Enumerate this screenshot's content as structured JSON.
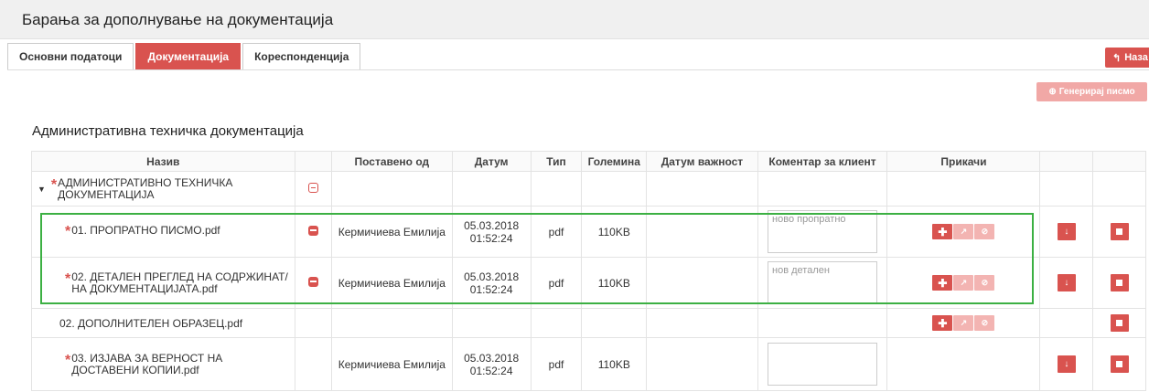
{
  "header": {
    "title": "Барања за дополнување на документација"
  },
  "tabs": [
    {
      "label": "Основни податоци",
      "active": false
    },
    {
      "label": "Документација",
      "active": true
    },
    {
      "label": "Кореспонденција",
      "active": false
    }
  ],
  "actions": {
    "back_label": "Наза",
    "generate_label": "Генерирај писмо"
  },
  "section": {
    "title": "Административна техничка документација"
  },
  "table": {
    "columns": [
      "Назив",
      "",
      "Поставено од",
      "Датум",
      "Тип",
      "Големина",
      "Датум важност",
      "Коментар за клиент",
      "Прикачи",
      "",
      ""
    ],
    "group": {
      "label": "АДМИНИСТРАТИВНО ТЕХНИЧКА ДОКУМЕНТАЦИЈА",
      "required": true
    },
    "rows": [
      {
        "name": "01. ПРОПРАТНО ПИСМО.pdf",
        "required": true,
        "uploaded_by": "Кермичиева Емилија",
        "date": "05.03.2018",
        "time": "01:52:24",
        "type": "pdf",
        "size": "110KB",
        "comment": "ново пропратно"
      },
      {
        "name": "02. ДЕТАЛЕН ПРЕГЛЕД НА СОДРЖИНАТА НА ДОКУМЕНТАЦИЈАТА.pdf",
        "name_line1": "02. ДЕТАЛЕН ПРЕГЛЕД НА СОДРЖИНАТ/",
        "name_line2": "НА ДОКУМЕНТАЦИЈАТА.pdf",
        "required": true,
        "uploaded_by": "Кермичиева Емилија",
        "date": "05.03.2018",
        "time": "01:52:24",
        "type": "pdf",
        "size": "110KB",
        "comment": "нов детален"
      },
      {
        "name": "02. ДОПОЛНИТЕЛЕН ОБРАЗЕЦ.pdf",
        "required": false
      },
      {
        "name_line1": "03. ИЗЈАВА ЗА ВЕРНОСТ НА",
        "name_line2": "ДОСТАВЕНИ КОПИИ.pdf",
        "required": true,
        "uploaded_by": "Кермичиева Емилија",
        "date": "05.03.2018",
        "time": "01:52:24",
        "type": "pdf",
        "size": "110KB",
        "comment": ""
      }
    ]
  },
  "icons": {
    "collapse": "caret-down-icon",
    "add": "plus-icon",
    "replace": "arrow-icon",
    "disable": "ban-icon",
    "download": "download-icon",
    "delete": "stop-icon"
  },
  "colors": {
    "accent": "#d9534f",
    "highlight": "#3cb043",
    "disabled_accent": "#f3b4b2"
  }
}
